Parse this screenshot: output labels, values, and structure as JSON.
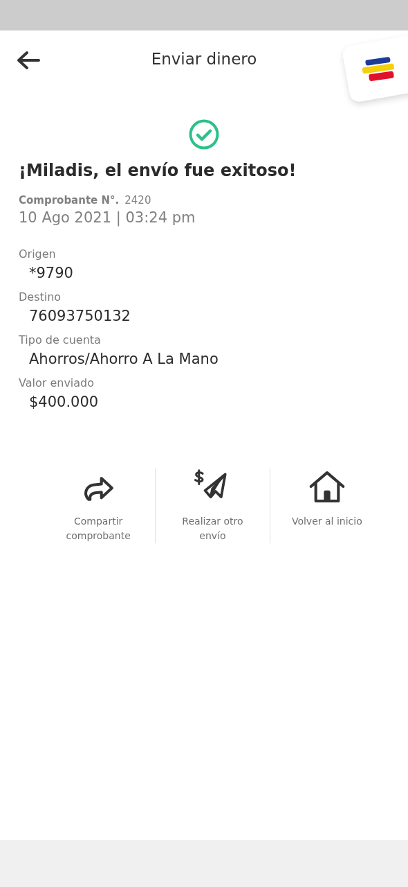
{
  "header": {
    "title": "Enviar dinero"
  },
  "result": {
    "message": "¡Miladis, el envío fue exitoso!",
    "receipt_label": "Comprobante N°.",
    "receipt_number": "2420",
    "datetime": "10 Ago 2021 | 03:24 pm"
  },
  "details": [
    {
      "label": "Origen",
      "value": "*9790"
    },
    {
      "label": "Destino",
      "value": "76093750132"
    },
    {
      "label": "Tipo de cuenta",
      "value": "Ahorros/Ahorro A La Mano"
    },
    {
      "label": "Valor enviado",
      "value": "$400.000"
    }
  ],
  "actions": [
    {
      "kind": "share",
      "label": "Compartir comprobante"
    },
    {
      "kind": "send",
      "label": "Realizar otro envío"
    },
    {
      "kind": "home",
      "label": "Volver al inicio"
    }
  ]
}
